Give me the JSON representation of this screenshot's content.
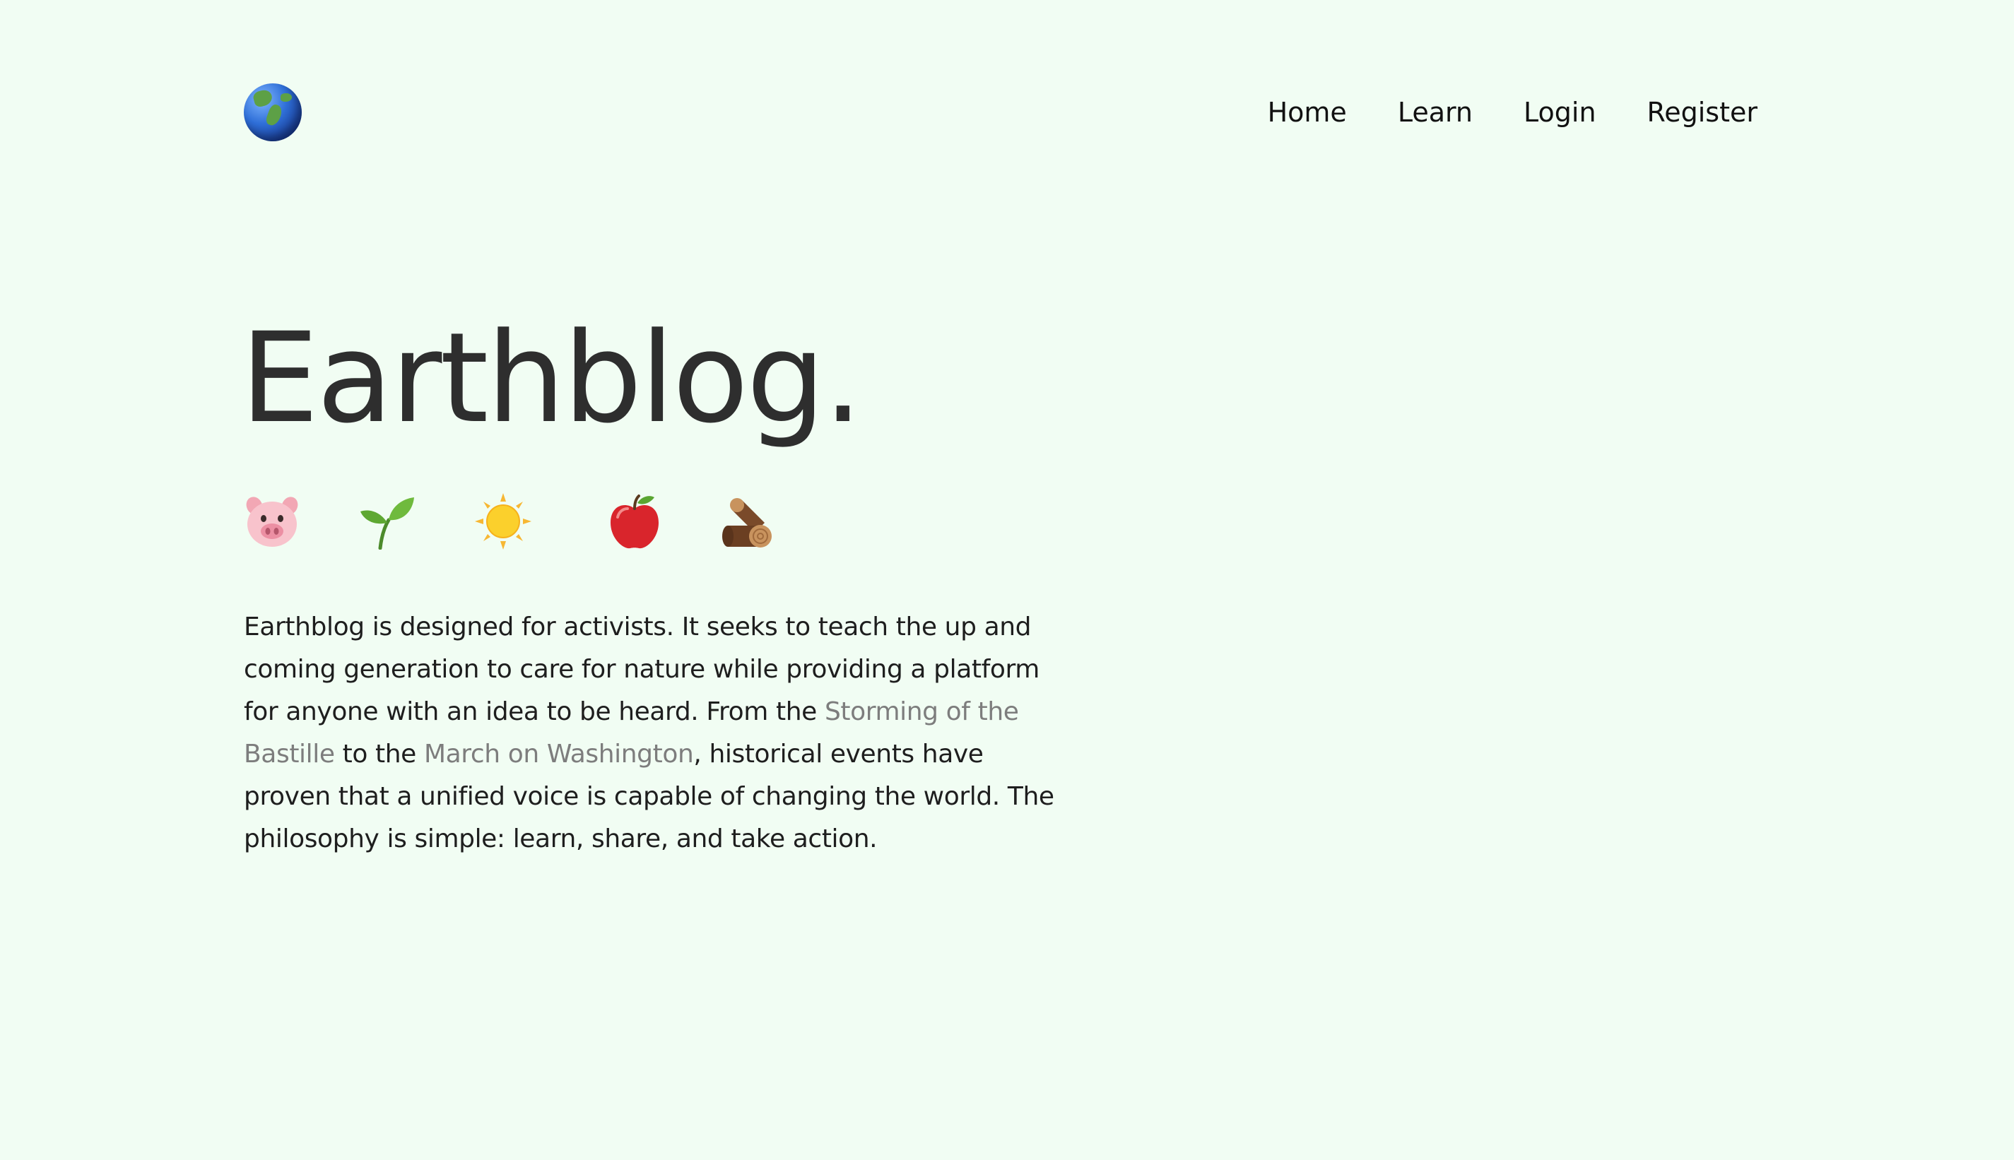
{
  "header": {
    "logo_icon": "globe-americas-icon",
    "nav": [
      {
        "label": "Home"
      },
      {
        "label": "Learn"
      },
      {
        "label": "Login"
      },
      {
        "label": "Register"
      }
    ]
  },
  "hero": {
    "title": "Earthblog.",
    "icons": [
      "pig-face-icon",
      "seedling-icon",
      "sun-icon",
      "red-apple-icon",
      "wood-log-icon"
    ]
  },
  "description": {
    "part1": "Earthblog is designed for activists. It seeks to teach the up and coming generation to care for nature while providing a platform for anyone with an idea to be heard. From the ",
    "link1": "Storming of the Bastille",
    "part2": " to the ",
    "link2": "March on Washington",
    "part3": ", historical events have proven that a unified voice is capable of changing the world. The philosophy is simple: learn, share, and take action."
  },
  "colors": {
    "background": "#f1fdf3",
    "text": "#1e1e1e",
    "link": "#7d7d7d"
  }
}
